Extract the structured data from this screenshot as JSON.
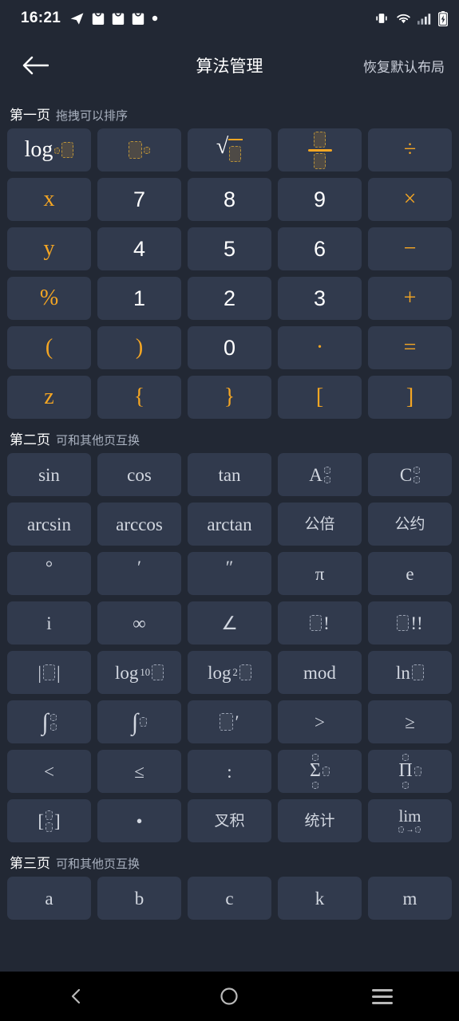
{
  "status_bar": {
    "time": "16:21",
    "left_icons": [
      "telegram-icon",
      "shopping-bag-icon",
      "shopping-bag-icon",
      "shopping-bag-icon",
      "dot-icon"
    ],
    "right_icons": [
      "vibrate-icon",
      "wifi-icon",
      "signal-icon",
      "battery-charging-icon"
    ]
  },
  "header": {
    "back_icon": "arrow-left-icon",
    "title": "算法管理",
    "action_label": "恢复默认布局"
  },
  "colors": {
    "background": "#222834",
    "key_fill": "#313a4d",
    "accent": "#f5a623",
    "text_primary": "#ffffff",
    "text_secondary": "#d2d7e0",
    "nav_bar": "#000000"
  },
  "sections": [
    {
      "title": "第一页",
      "subtitle": "拖拽可以排序",
      "keys": [
        {
          "name": "log-base-key",
          "kind": "tpl-log",
          "label": "log"
        },
        {
          "name": "power-key",
          "kind": "tpl-power",
          "label": "□^□"
        },
        {
          "name": "sqrt-key",
          "kind": "tpl-sqrt",
          "label": "√□"
        },
        {
          "name": "fraction-key",
          "kind": "tpl-frac",
          "label": "□/□"
        },
        {
          "name": "divide-key",
          "kind": "op",
          "label": "÷"
        },
        {
          "name": "variable-x-key",
          "kind": "var",
          "label": "x"
        },
        {
          "name": "digit-7-key",
          "kind": "num",
          "label": "7"
        },
        {
          "name": "digit-8-key",
          "kind": "num",
          "label": "8"
        },
        {
          "name": "digit-9-key",
          "kind": "num",
          "label": "9"
        },
        {
          "name": "multiply-key",
          "kind": "op",
          "label": "×"
        },
        {
          "name": "variable-y-key",
          "kind": "var",
          "label": "y"
        },
        {
          "name": "digit-4-key",
          "kind": "num",
          "label": "4"
        },
        {
          "name": "digit-5-key",
          "kind": "num",
          "label": "5"
        },
        {
          "name": "digit-6-key",
          "kind": "num",
          "label": "6"
        },
        {
          "name": "minus-key",
          "kind": "op",
          "label": "−"
        },
        {
          "name": "percent-key",
          "kind": "op",
          "label": "%"
        },
        {
          "name": "digit-1-key",
          "kind": "num",
          "label": "1"
        },
        {
          "name": "digit-2-key",
          "kind": "num",
          "label": "2"
        },
        {
          "name": "digit-3-key",
          "kind": "num",
          "label": "3"
        },
        {
          "name": "plus-key",
          "kind": "op",
          "label": "+"
        },
        {
          "name": "paren-open-key",
          "kind": "op",
          "label": "("
        },
        {
          "name": "paren-close-key",
          "kind": "op",
          "label": ")"
        },
        {
          "name": "digit-0-key",
          "kind": "num",
          "label": "0"
        },
        {
          "name": "decimal-point-key",
          "kind": "op",
          "label": "·"
        },
        {
          "name": "equals-key",
          "kind": "op",
          "label": "="
        },
        {
          "name": "variable-z-key",
          "kind": "var",
          "label": "z"
        },
        {
          "name": "brace-open-key",
          "kind": "op",
          "label": "{"
        },
        {
          "name": "brace-close-key",
          "kind": "op",
          "label": "}"
        },
        {
          "name": "bracket-open-key",
          "kind": "op",
          "label": "["
        },
        {
          "name": "bracket-close-key",
          "kind": "op",
          "label": "]"
        }
      ]
    },
    {
      "title": "第二页",
      "subtitle": "可和其他页互换",
      "keys": [
        {
          "name": "sin-key",
          "kind": "plain",
          "label": "sin"
        },
        {
          "name": "cos-key",
          "kind": "plain",
          "label": "cos"
        },
        {
          "name": "tan-key",
          "kind": "plain",
          "label": "tan"
        },
        {
          "name": "permutation-key",
          "kind": "tpl-perm",
          "label": "A"
        },
        {
          "name": "combination-key",
          "kind": "tpl-perm",
          "label": "C"
        },
        {
          "name": "arcsin-key",
          "kind": "plain",
          "label": "arcsin"
        },
        {
          "name": "arccos-key",
          "kind": "plain",
          "label": "arccos"
        },
        {
          "name": "arctan-key",
          "kind": "plain",
          "label": "arctan"
        },
        {
          "name": "lcm-key",
          "kind": "cjk",
          "label": "公倍"
        },
        {
          "name": "gcd-key",
          "kind": "cjk",
          "label": "公约"
        },
        {
          "name": "degree-key",
          "kind": "plain-sup",
          "label": "°"
        },
        {
          "name": "arcminute-key",
          "kind": "plain-sup",
          "label": "′"
        },
        {
          "name": "arcsecond-key",
          "kind": "plain-sup",
          "label": "″"
        },
        {
          "name": "pi-key",
          "kind": "plain",
          "label": "π"
        },
        {
          "name": "euler-e-key",
          "kind": "plain",
          "label": "e"
        },
        {
          "name": "imaginary-unit-key",
          "kind": "plain",
          "label": "i"
        },
        {
          "name": "infinity-key",
          "kind": "plain",
          "label": "∞"
        },
        {
          "name": "angle-key",
          "kind": "plain",
          "label": "∠"
        },
        {
          "name": "factorial-key",
          "kind": "tpl-fact",
          "label": "□!"
        },
        {
          "name": "double-factorial-key",
          "kind": "tpl-fact2",
          "label": "□!!"
        },
        {
          "name": "absolute-value-key",
          "kind": "tpl-abs",
          "label": "|□|"
        },
        {
          "name": "log10-key",
          "kind": "tpl-log10",
          "label": "log₁₀□"
        },
        {
          "name": "log2-key",
          "kind": "tpl-log2",
          "label": "log₂□"
        },
        {
          "name": "mod-key",
          "kind": "plain",
          "label": "mod"
        },
        {
          "name": "natural-log-key",
          "kind": "tpl-ln",
          "label": "ln□"
        },
        {
          "name": "definite-integral-key",
          "kind": "tpl-defint",
          "label": "∫"
        },
        {
          "name": "indefinite-integral-key",
          "kind": "tpl-int",
          "label": "∫□"
        },
        {
          "name": "derivative-key",
          "kind": "tpl-deriv",
          "label": "□′"
        },
        {
          "name": "greater-than-key",
          "kind": "plain",
          "label": ">"
        },
        {
          "name": "greater-equal-key",
          "kind": "plain",
          "label": "≥"
        },
        {
          "name": "less-than-key",
          "kind": "plain",
          "label": "<"
        },
        {
          "name": "less-equal-key",
          "kind": "plain",
          "label": "≤"
        },
        {
          "name": "ratio-key",
          "kind": "plain",
          "label": ":"
        },
        {
          "name": "summation-key",
          "kind": "tpl-sum",
          "label": "Σ"
        },
        {
          "name": "product-key",
          "kind": "tpl-prod",
          "label": "Π"
        },
        {
          "name": "matrix-key",
          "kind": "tpl-matrix",
          "label": "[□]"
        },
        {
          "name": "dot-product-key",
          "kind": "plain",
          "label": "•"
        },
        {
          "name": "cross-product-key",
          "kind": "cjk",
          "label": "叉积"
        },
        {
          "name": "statistics-key",
          "kind": "cjk",
          "label": "统计"
        },
        {
          "name": "limit-key",
          "kind": "tpl-lim",
          "label": "lim",
          "sub_label": "□→□"
        }
      ]
    },
    {
      "title": "第三页",
      "subtitle": "可和其他页互换",
      "keys": [
        {
          "name": "constant-a-key",
          "kind": "plain",
          "label": "a"
        },
        {
          "name": "constant-b-key",
          "kind": "plain",
          "label": "b"
        },
        {
          "name": "constant-c-key",
          "kind": "plain",
          "label": "c"
        },
        {
          "name": "constant-k-key",
          "kind": "plain",
          "label": "k"
        },
        {
          "name": "constant-m-key",
          "kind": "plain",
          "label": "m"
        }
      ]
    }
  ],
  "nav_bar": {
    "back_icon": "nav-back-icon",
    "home_icon": "nav-home-icon",
    "recents_icon": "nav-recents-icon"
  }
}
